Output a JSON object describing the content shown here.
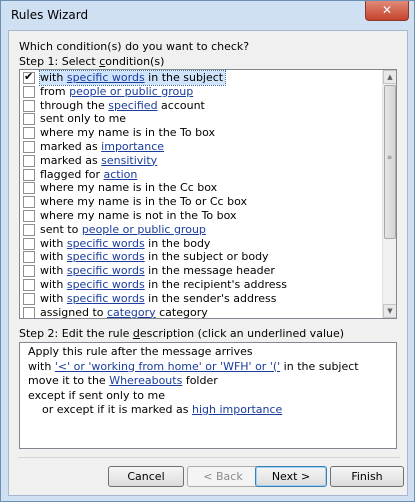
{
  "window": {
    "title": "Rules Wizard",
    "close_glyph": "✕"
  },
  "question": "Which condition(s) do you want to check?",
  "step1": {
    "prefix": "Step 1: Select ",
    "underlined": "c",
    "suffix": "ondition(s)"
  },
  "conditions": [
    {
      "checked": true,
      "selected": true,
      "parts": [
        {
          "t": "with "
        },
        {
          "t": "specific words",
          "link": true
        },
        {
          "t": " in the subject"
        }
      ]
    },
    {
      "checked": false,
      "selected": false,
      "parts": [
        {
          "t": "from "
        },
        {
          "t": "people or public group",
          "link": true
        }
      ]
    },
    {
      "checked": false,
      "selected": false,
      "parts": [
        {
          "t": "through the "
        },
        {
          "t": "specified",
          "link": true
        },
        {
          "t": " account"
        }
      ]
    },
    {
      "checked": false,
      "selected": false,
      "parts": [
        {
          "t": "sent only to me"
        }
      ]
    },
    {
      "checked": false,
      "selected": false,
      "parts": [
        {
          "t": "where my name is in the To box"
        }
      ]
    },
    {
      "checked": false,
      "selected": false,
      "parts": [
        {
          "t": "marked as "
        },
        {
          "t": "importance",
          "link": true
        }
      ]
    },
    {
      "checked": false,
      "selected": false,
      "parts": [
        {
          "t": "marked as "
        },
        {
          "t": "sensitivity",
          "link": true
        }
      ]
    },
    {
      "checked": false,
      "selected": false,
      "parts": [
        {
          "t": "flagged for "
        },
        {
          "t": "action",
          "link": true
        }
      ]
    },
    {
      "checked": false,
      "selected": false,
      "parts": [
        {
          "t": "where my name is in the Cc box"
        }
      ]
    },
    {
      "checked": false,
      "selected": false,
      "parts": [
        {
          "t": "where my name is in the To or Cc box"
        }
      ]
    },
    {
      "checked": false,
      "selected": false,
      "parts": [
        {
          "t": "where my name is not in the To box"
        }
      ]
    },
    {
      "checked": false,
      "selected": false,
      "parts": [
        {
          "t": "sent to "
        },
        {
          "t": "people or public group",
          "link": true
        }
      ]
    },
    {
      "checked": false,
      "selected": false,
      "parts": [
        {
          "t": "with "
        },
        {
          "t": "specific words",
          "link": true
        },
        {
          "t": " in the body"
        }
      ]
    },
    {
      "checked": false,
      "selected": false,
      "parts": [
        {
          "t": "with "
        },
        {
          "t": "specific words",
          "link": true
        },
        {
          "t": " in the subject or body"
        }
      ]
    },
    {
      "checked": false,
      "selected": false,
      "parts": [
        {
          "t": "with "
        },
        {
          "t": "specific words",
          "link": true
        },
        {
          "t": " in the message header"
        }
      ]
    },
    {
      "checked": false,
      "selected": false,
      "parts": [
        {
          "t": "with "
        },
        {
          "t": "specific words",
          "link": true
        },
        {
          "t": " in the recipient's address"
        }
      ]
    },
    {
      "checked": false,
      "selected": false,
      "parts": [
        {
          "t": "with "
        },
        {
          "t": "specific words",
          "link": true
        },
        {
          "t": " in the sender's address"
        }
      ]
    },
    {
      "checked": false,
      "selected": false,
      "parts": [
        {
          "t": "assigned to "
        },
        {
          "t": "category",
          "link": true
        },
        {
          "t": " category"
        }
      ]
    }
  ],
  "scrollbar": {
    "up_glyph": "▲",
    "down_glyph": "▼",
    "grip_glyph": "≡"
  },
  "step2": {
    "prefix": "Step 2: Edit the rule ",
    "underlined": "d",
    "suffix": "escription (click an underlined value)"
  },
  "description": [
    {
      "indent": 0,
      "parts": [
        {
          "t": "Apply this rule after the message arrives"
        }
      ]
    },
    {
      "indent": 0,
      "parts": [
        {
          "t": "with "
        },
        {
          "t": "'<' or 'working from home' or 'WFH' or '('",
          "link": true
        },
        {
          "t": " in the subject"
        }
      ]
    },
    {
      "indent": 0,
      "parts": [
        {
          "t": "move it to the "
        },
        {
          "t": "Whereabouts",
          "link": true
        },
        {
          "t": " folder"
        }
      ]
    },
    {
      "indent": 0,
      "parts": [
        {
          "t": "except if sent only to me"
        }
      ]
    },
    {
      "indent": 1,
      "parts": [
        {
          "t": "or except if it is marked as "
        },
        {
          "t": "high importance",
          "link": true
        }
      ]
    }
  ],
  "buttons": {
    "cancel": "Cancel",
    "back": "< Back",
    "next": "Next >",
    "finish": "Finish"
  },
  "colors": {
    "link": "#1a3c9c",
    "selection": "#cfe4fb",
    "frame": "#cfe0f3",
    "close": "#c5432c"
  }
}
